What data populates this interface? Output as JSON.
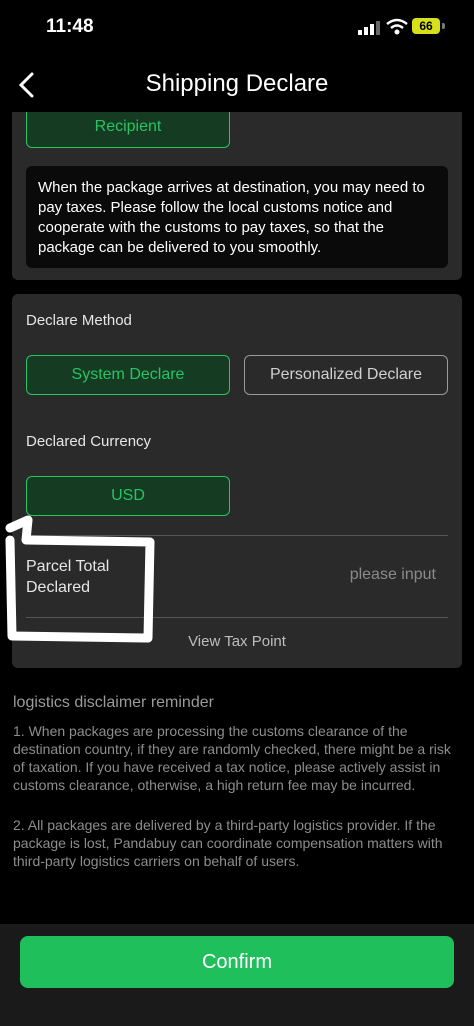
{
  "status": {
    "time": "11:48",
    "battery": "66"
  },
  "nav": {
    "title": "Shipping Declare"
  },
  "recipient_button": "Recipient",
  "tax_notice": "When the package arrives at destination, you may need to pay taxes. Please follow the local customs notice and cooperate with the customs to pay taxes, so that the package can be delivered to you smoothly.",
  "declare": {
    "method_label": "Declare Method",
    "method_options": [
      "System Declare",
      "Personalized Declare"
    ],
    "currency_label": "Declared Currency",
    "currency_value": "USD",
    "parcel_total_label": "Parcel Total Declared",
    "parcel_total_placeholder": "please input",
    "view_tax_point": "View Tax Point"
  },
  "disclaimer": {
    "title": "logistics disclaimer reminder",
    "items": [
      "1. When packages are processing the customs clearance of the destination country, if they are randomly checked, there might be a risk of taxation. If you have received a tax notice, please actively assist in customs clearance, otherwise, a high return fee may be incurred.",
      "2. All packages are delivered by a third-party logistics provider. If the package is lost, Pandabuy can coordinate compensation matters with third-party logistics carriers on behalf of users."
    ]
  },
  "confirm_label": "Confirm",
  "colors": {
    "accent": "#1fbf5c",
    "card": "#2a2a2a",
    "background": "#000000"
  }
}
